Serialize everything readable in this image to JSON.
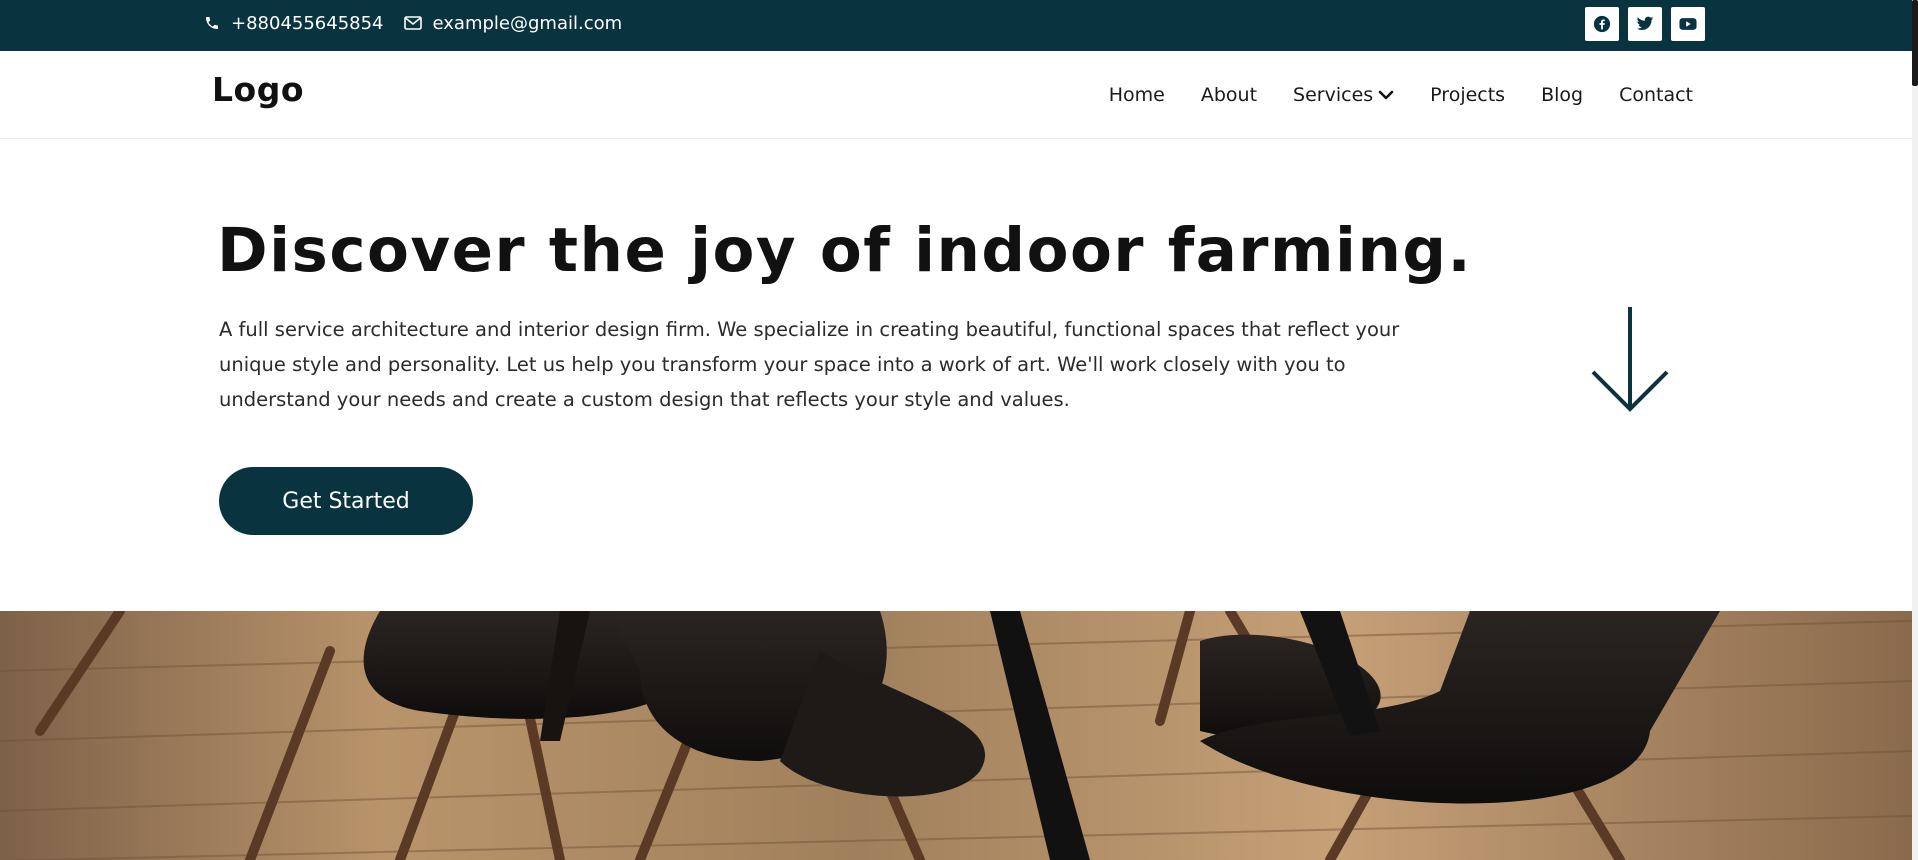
{
  "topbar": {
    "phone": "+880455645854",
    "email": "example@gmail.com",
    "social": [
      "facebook-icon",
      "twitter-icon",
      "youtube-icon"
    ],
    "bg_color": "#09343f"
  },
  "header": {
    "logo": "Logo",
    "nav": {
      "home": "Home",
      "about": "About",
      "services": "Services",
      "projects": "Projects",
      "blog": "Blog",
      "contact": "Contact"
    }
  },
  "hero": {
    "title": "Discover the joy of indoor farming.",
    "text": "A full service architecture and interior design firm. We specialize in creating beautiful, functional spaces that reflect your unique style and personality. Let us help you transform your space into a work of art. We'll work closely with you to understand your needs and create a custom design that reflects your style and values.",
    "cta": "Get Started",
    "accent_color": "#09343f"
  },
  "icons": {
    "phone": "phone-icon",
    "email": "envelope-icon",
    "services_dropdown": "chevron-down-icon",
    "scroll": "arrow-down-icon"
  }
}
